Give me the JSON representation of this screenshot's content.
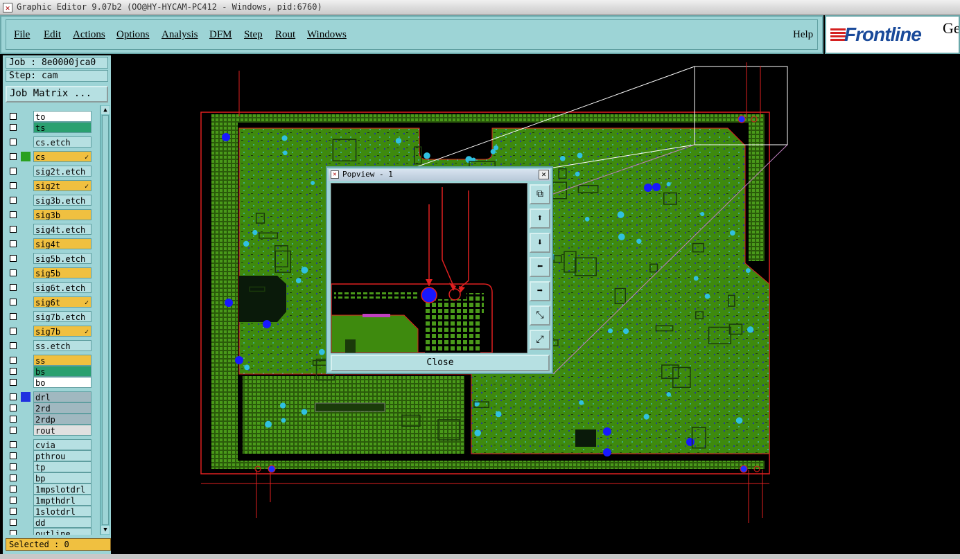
{
  "window": {
    "title": "Graphic Editor 9.07b2 (OO@HY-HYCAM-PC412 - Windows, pid:6760)"
  },
  "menu": {
    "items": [
      {
        "label": "File"
      },
      {
        "label": "Edit"
      },
      {
        "label": "Actions"
      },
      {
        "label": "Options"
      },
      {
        "label": "Analysis"
      },
      {
        "label": "DFM"
      },
      {
        "label": "Step"
      },
      {
        "label": "Rout"
      },
      {
        "label": "Windows"
      }
    ],
    "help": "Help"
  },
  "brand": {
    "logo": "Frontline",
    "suffix": "Ge"
  },
  "job": {
    "job_line": "Job : 8e0000jca0",
    "step_line": "Step: cam",
    "matrix_button": "Job Matrix ..."
  },
  "layers": [
    {
      "name": "to",
      "color": "#ffffff",
      "swatch": "",
      "star": ""
    },
    {
      "name": "ts",
      "color": "#2aa070",
      "swatch": "",
      "star": ""
    },
    {
      "name": "cs.etch",
      "color": "#b6e0e2",
      "swatch": "",
      "star": ""
    },
    {
      "name": "cs",
      "color": "#f0c040",
      "swatch": "#2aa020",
      "star": "✓"
    },
    {
      "name": "sig2t.etch",
      "color": "#b6e0e2",
      "swatch": "",
      "star": ""
    },
    {
      "name": "sig2t",
      "color": "#f0c040",
      "swatch": "",
      "star": "✓"
    },
    {
      "name": "sig3b.etch",
      "color": "#b6e0e2",
      "swatch": "",
      "star": ""
    },
    {
      "name": "sig3b",
      "color": "#f0c040",
      "swatch": "",
      "star": ""
    },
    {
      "name": "sig4t.etch",
      "color": "#b6e0e2",
      "swatch": "",
      "star": ""
    },
    {
      "name": "sig4t",
      "color": "#f0c040",
      "swatch": "",
      "star": ""
    },
    {
      "name": "sig5b.etch",
      "color": "#b6e0e2",
      "swatch": "",
      "star": ""
    },
    {
      "name": "sig5b",
      "color": "#f0c040",
      "swatch": "",
      "star": ""
    },
    {
      "name": "sig6t.etch",
      "color": "#b6e0e2",
      "swatch": "",
      "star": ""
    },
    {
      "name": "sig6t",
      "color": "#f0c040",
      "swatch": "",
      "star": "✓"
    },
    {
      "name": "sig7b.etch",
      "color": "#b6e0e2",
      "swatch": "",
      "star": ""
    },
    {
      "name": "sig7b",
      "color": "#f0c040",
      "swatch": "",
      "star": "✓"
    },
    {
      "name": "ss.etch",
      "color": "#b6e0e2",
      "swatch": "",
      "star": ""
    },
    {
      "name": "ss",
      "color": "#f0c040",
      "swatch": "",
      "star": ""
    },
    {
      "name": "bs",
      "color": "#2aa070",
      "swatch": "",
      "star": ""
    },
    {
      "name": "bo",
      "color": "#ffffff",
      "swatch": "",
      "star": ""
    },
    {
      "name": "drl",
      "color": "#a0b8c0",
      "swatch": "#2030e0",
      "star": ""
    },
    {
      "name": "2rd",
      "color": "#a0b8c0",
      "swatch": "",
      "star": ""
    },
    {
      "name": "2rdp",
      "color": "#a0b8c0",
      "swatch": "",
      "star": ""
    },
    {
      "name": "rout",
      "color": "#e0e0e0",
      "swatch": "",
      "star": ""
    },
    {
      "name": "cvia",
      "color": "#b6e0e2",
      "swatch": "",
      "star": ""
    },
    {
      "name": "pthrou",
      "color": "#b6e0e2",
      "swatch": "",
      "star": ""
    },
    {
      "name": "tp",
      "color": "#b6e0e2",
      "swatch": "",
      "star": ""
    },
    {
      "name": "bp",
      "color": "#b6e0e2",
      "swatch": "",
      "star": ""
    },
    {
      "name": "1mpslotdrl",
      "color": "#b6e0e2",
      "swatch": "",
      "star": ""
    },
    {
      "name": "1mpthdrl",
      "color": "#b6e0e2",
      "swatch": "",
      "star": ""
    },
    {
      "name": "1slotdrl",
      "color": "#b6e0e2",
      "swatch": "",
      "star": ""
    },
    {
      "name": "dd",
      "color": "#b6e0e2",
      "swatch": "",
      "star": ""
    },
    {
      "name": "outline",
      "color": "#b6e0e2",
      "swatch": "",
      "star": ""
    }
  ],
  "status": {
    "selected": "Selected : 0"
  },
  "popview": {
    "title": "Popview - 1",
    "close_label": "Close",
    "tools": [
      "zoom-home-icon",
      "pan-up-icon",
      "pan-down-icon",
      "pan-left-icon",
      "pan-right-icon",
      "zoom-out-icon",
      "zoom-in-icon"
    ]
  },
  "colors": {
    "board": "#3e8a0e",
    "outline": "#e02020",
    "panel": "#9dd4d6",
    "via_blue": "#1818ff",
    "via_cyan": "#30c0e0"
  }
}
